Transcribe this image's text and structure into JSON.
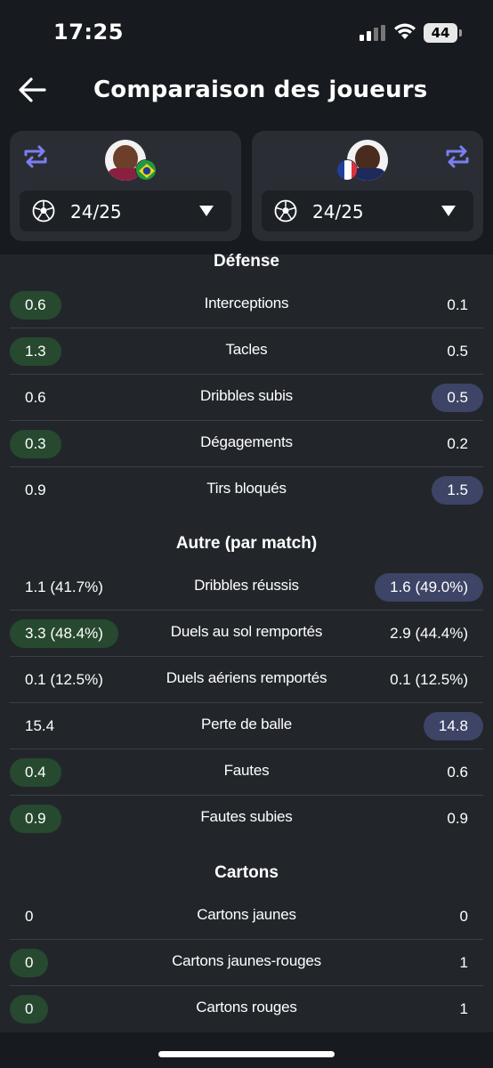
{
  "status": {
    "time": "17:25",
    "battery": "44"
  },
  "header": {
    "title": "Comparaison des joueurs"
  },
  "players": [
    {
      "season": "24/25",
      "flag": "Brazil"
    },
    {
      "season": "24/25",
      "flag": "France"
    }
  ],
  "sections": [
    {
      "title": "Défense",
      "rows": [
        {
          "label": "Interceptions",
          "left": "0.6",
          "right": "0.1",
          "hl": "left"
        },
        {
          "label": "Tacles",
          "left": "1.3",
          "right": "0.5",
          "hl": "left"
        },
        {
          "label": "Dribbles subis",
          "left": "0.6",
          "right": "0.5",
          "hl": "right"
        },
        {
          "label": "Dégagements",
          "left": "0.3",
          "right": "0.2",
          "hl": "left"
        },
        {
          "label": "Tirs bloqués",
          "left": "0.9",
          "right": "1.5",
          "hl": "right"
        }
      ]
    },
    {
      "title": "Autre (par match)",
      "rows": [
        {
          "label": "Dribbles réussis",
          "left": "1.1 (41.7%)",
          "right": "1.6 (49.0%)",
          "hl": "right"
        },
        {
          "label": "Duels au sol remportés",
          "left": "3.3 (48.4%)",
          "right": "2.9 (44.4%)",
          "hl": "left"
        },
        {
          "label": "Duels aériens remportés",
          "left": "0.1 (12.5%)",
          "right": "0.1 (12.5%)",
          "hl": "none"
        },
        {
          "label": "Perte de balle",
          "left": "15.4",
          "right": "14.8",
          "hl": "right"
        },
        {
          "label": "Fautes",
          "left": "0.4",
          "right": "0.6",
          "hl": "left"
        },
        {
          "label": "Fautes subies",
          "left": "0.9",
          "right": "0.9",
          "hl": "left"
        }
      ]
    },
    {
      "title": "Cartons",
      "rows": [
        {
          "label": "Cartons jaunes",
          "left": "0",
          "right": "0",
          "hl": "none"
        },
        {
          "label": "Cartons jaunes-rouges",
          "left": "0",
          "right": "1",
          "hl": "left"
        },
        {
          "label": "Cartons rouges",
          "left": "0",
          "right": "1",
          "hl": "left"
        }
      ]
    }
  ],
  "colors": {
    "background": "#22262b",
    "header": "#171a1e",
    "card": "#2a2e34",
    "accent": "#7b7ff0",
    "left_highlight": "#27492f",
    "right_highlight": "#3d4466"
  }
}
